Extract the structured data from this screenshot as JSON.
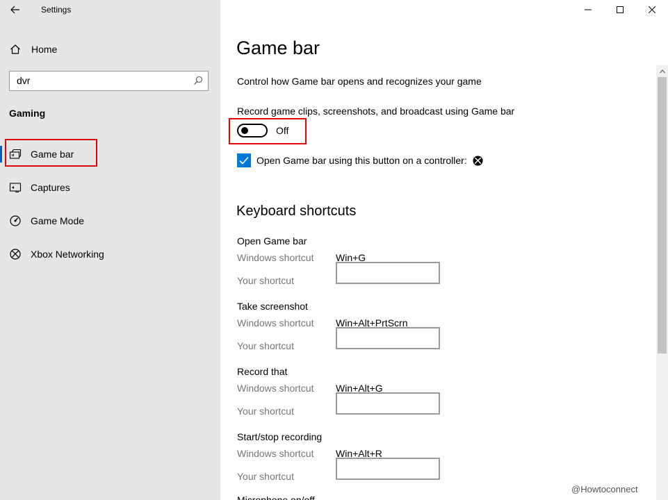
{
  "window": {
    "title": "Settings"
  },
  "sidebar": {
    "home_label": "Home",
    "search": {
      "value": "dvr",
      "placeholder": ""
    },
    "section_title": "Gaming",
    "items": [
      {
        "label": "Game bar",
        "icon": "game-bar-icon",
        "active": true
      },
      {
        "label": "Captures",
        "icon": "captures-icon",
        "active": false
      },
      {
        "label": "Game Mode",
        "icon": "game-mode-icon",
        "active": false
      },
      {
        "label": "Xbox Networking",
        "icon": "xbox-icon",
        "active": false
      }
    ]
  },
  "main": {
    "title": "Game bar",
    "description": "Control how Game bar opens and recognizes your game",
    "record_label": "Record game clips, screenshots, and broadcast using Game bar",
    "record_toggle": {
      "state": "Off"
    },
    "controller_checkbox": {
      "label": "Open Game bar using this button on a controller:",
      "checked": true
    },
    "shortcuts_title": "Keyboard shortcuts",
    "windows_shortcut_label": "Windows shortcut",
    "your_shortcut_label": "Your shortcut",
    "shortcuts": [
      {
        "name": "Open Game bar",
        "windows": "Win+G",
        "yours": ""
      },
      {
        "name": "Take screenshot",
        "windows": "Win+Alt+PrtScrn",
        "yours": ""
      },
      {
        "name": "Record that",
        "windows": "Win+Alt+G",
        "yours": ""
      },
      {
        "name": "Start/stop recording",
        "windows": "Win+Alt+R",
        "yours": ""
      }
    ],
    "cut_off_text": "Microphone on/off"
  },
  "watermark": "@Howtoconnect",
  "colors": {
    "accent": "#0078d7",
    "highlight_box": "#e00000",
    "sidebar_bg": "#e6e6e6"
  }
}
